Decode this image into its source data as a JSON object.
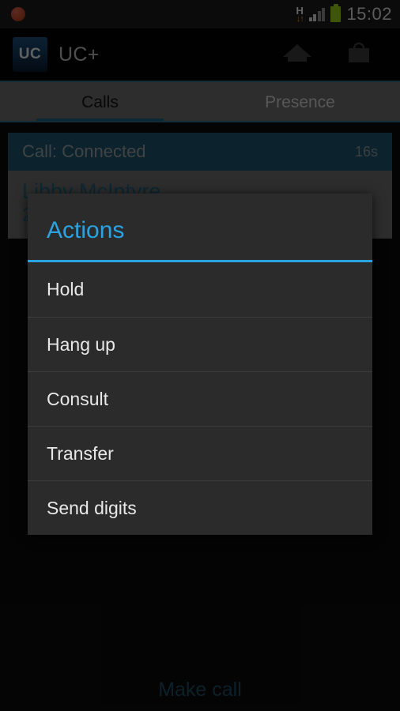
{
  "status_bar": {
    "notification_icon": "red-dot-notification-icon",
    "network_type": "H",
    "network_arrows": "↓↑",
    "signal_icon": "signal-bars-icon",
    "signal_bars_active": 2,
    "signal_bars_total": 4,
    "battery_icon": "battery-full-icon",
    "battery_color": "#96cc17",
    "time": "15:02"
  },
  "app_bar": {
    "logo_text": "UC",
    "title": "UC+",
    "home_icon": "home-icon",
    "briefcase_icon": "briefcase-icon"
  },
  "tabs": [
    {
      "label": "Calls",
      "active": true
    },
    {
      "label": "Presence",
      "active": false
    }
  ],
  "call": {
    "status": "Call: Connected",
    "duration": "16s",
    "contact_name": "Libby McIntyre",
    "contact_number": "2",
    "status_bg_color": "#1d556e",
    "body_bg_color": "#6b6b6b",
    "text_color": "#1f5f7d"
  },
  "make_call_button": {
    "label": "Make call",
    "color": "#1b4d63"
  },
  "dialog": {
    "title": "Actions",
    "accent_color": "#2aa3e0",
    "background_color": "#2b2b2b",
    "items": [
      {
        "label": "Hold"
      },
      {
        "label": "Hang up"
      },
      {
        "label": "Consult"
      },
      {
        "label": "Transfer"
      },
      {
        "label": "Send digits"
      }
    ]
  }
}
